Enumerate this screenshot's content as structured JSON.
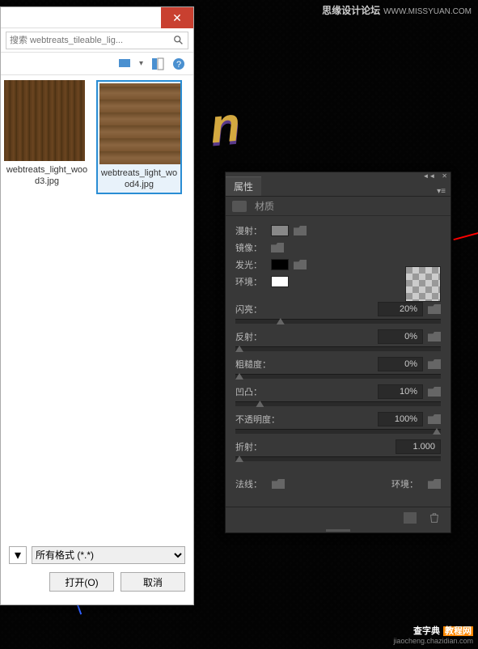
{
  "watermark_top": {
    "title": "思缘设计论坛",
    "url": "WWW.MISSYUAN.COM"
  },
  "watermark_bottom": {
    "title": "查字典",
    "tag": "教程网",
    "url": "jiaocheng.chazidian.com"
  },
  "file_dialog": {
    "search_placeholder": "搜索 webtreats_tileable_lig...",
    "files": [
      {
        "name": "webtreats_light_wood3.jpg"
      },
      {
        "name": "webtreats_light_wood4.jpg"
      }
    ],
    "format_select": "所有格式 (*.*)",
    "open_btn": "打开(O)",
    "cancel_btn": "取消"
  },
  "props": {
    "tab": "属性",
    "subtab": "材质",
    "swatches": {
      "diffuse_label": "漫射：",
      "diffuse_color": "#888888",
      "specular_label": "镜像：",
      "glow_label": "发光：",
      "glow_color": "#000000",
      "ambient_label": "环境：",
      "ambient_color": "#ffffff"
    },
    "sliders": {
      "shine": {
        "label": "闪亮：",
        "value": "20%",
        "pos": 20
      },
      "reflect": {
        "label": "反射：",
        "value": "0%",
        "pos": 0
      },
      "rough": {
        "label": "粗糙度：",
        "value": "0%",
        "pos": 0
      },
      "bump": {
        "label": "凹凸：",
        "value": "10%",
        "pos": 10
      },
      "opacity": {
        "label": "不透明度：",
        "value": "100%",
        "pos": 100
      },
      "refract": {
        "label": "折射：",
        "value": "1.000",
        "pos": 0
      }
    },
    "normal_label": "法线：",
    "env_label": "环境："
  }
}
